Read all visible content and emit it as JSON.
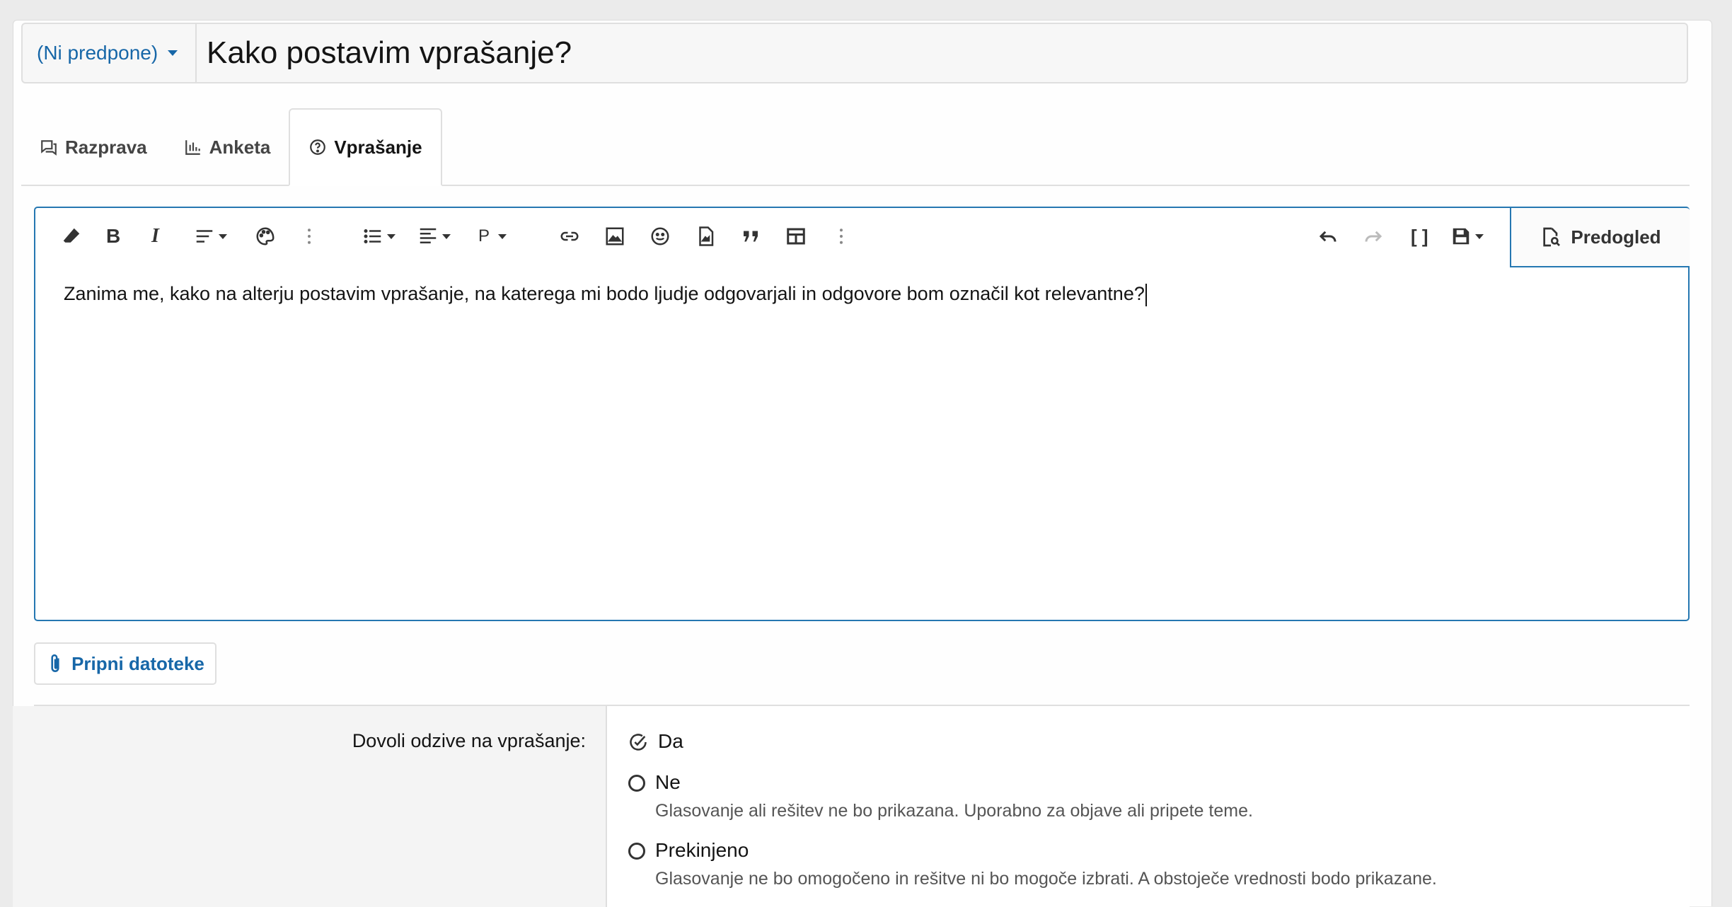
{
  "title_row": {
    "prefix_label": "(Ni predpone)",
    "title_value": "Kako postavim vprašanje?"
  },
  "tabs": [
    {
      "label": "Razprava",
      "icon": "discussion-icon",
      "active": false
    },
    {
      "label": "Anketa",
      "icon": "poll-icon",
      "active": false
    },
    {
      "label": "Vprašanje",
      "icon": "question-icon",
      "active": true
    }
  ],
  "editor": {
    "toolbar_icons": [
      "eraser-icon",
      "bold-icon",
      "italic-icon",
      "text-style-icon",
      "palette-icon",
      "more-vertical-icon",
      "list-icon",
      "align-icon",
      "paragraph-icon",
      "link-icon",
      "image-icon",
      "emoji-icon",
      "media-icon",
      "quote-icon",
      "table-icon",
      "more-vertical-icon",
      "undo-icon",
      "redo-icon",
      "bbcode-icon",
      "save-draft-icon"
    ],
    "paragraph_label": "P",
    "bbcode_label": "[ ]",
    "preview_label": "Predogled",
    "content": "Zanima me, kako na alterju postavim vprašanje, na katerega mi bodo ljudje odgovarjali in odgovore bom označil kot relevantne?"
  },
  "attach_label": "Pripni datoteke",
  "responses": {
    "label": "Dovoli odzive na vprašanje:",
    "choices": [
      {
        "label": "Da",
        "selected": true,
        "hint": ""
      },
      {
        "label": "Ne",
        "selected": false,
        "hint": "Glasovanje ali rešitev ne bo prikazana. Uporabno za objave ali pripete teme."
      },
      {
        "label": "Prekinjeno",
        "selected": false,
        "hint": "Glasovanje ne bo omogočeno in rešitve ni bo mogoče izbrati. A obstoječe vrednosti bodo prikazane."
      }
    ]
  },
  "colors": {
    "accent": "#1767a8",
    "editor_border": "#2577b1"
  }
}
